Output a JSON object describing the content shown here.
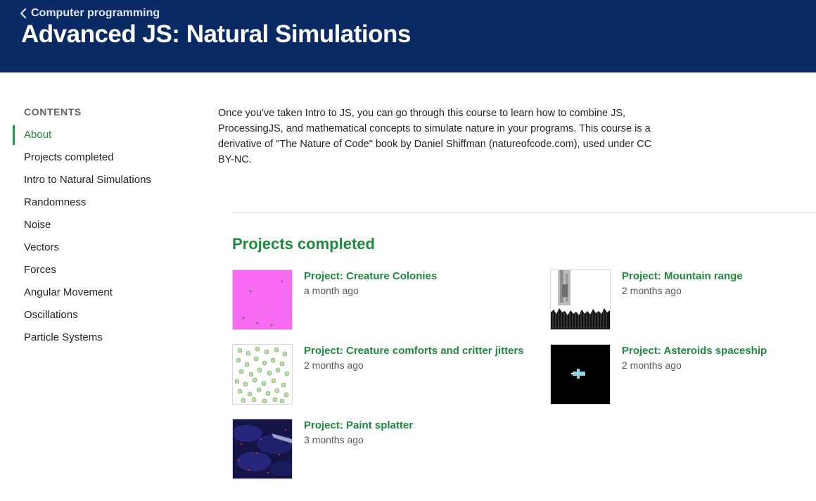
{
  "header": {
    "back_label": "Computer programming",
    "title": "Advanced JS: Natural Simulations"
  },
  "sidebar": {
    "heading": "CONTENTS",
    "items": [
      {
        "label": "About",
        "active": true
      },
      {
        "label": "Projects completed"
      },
      {
        "label": "Intro to Natural Simulations"
      },
      {
        "label": "Randomness"
      },
      {
        "label": "Noise"
      },
      {
        "label": "Vectors"
      },
      {
        "label": "Forces"
      },
      {
        "label": "Angular Movement"
      },
      {
        "label": "Oscillations"
      },
      {
        "label": "Particle Systems"
      }
    ]
  },
  "about": {
    "text": "Once you've taken Intro to JS, you can go through this course to learn how to combine JS, ProcessingJS, and mathematical concepts to simulate nature in your programs. This course is a derivative of \"The Nature of Code\" book by Daniel Shiffman (natureofcode.com), used under CC BY-NC."
  },
  "projects": {
    "heading": "Projects completed",
    "items": [
      {
        "title": "Project: Creature Colonies",
        "date": "a month ago"
      },
      {
        "title": "Project: Mountain range",
        "date": "2 months ago"
      },
      {
        "title": "Project: Creature comforts and critter jitters",
        "date": "2 months ago"
      },
      {
        "title": "Project: Asteroids spaceship",
        "date": "2 months ago"
      },
      {
        "title": "Project: Paint splatter",
        "date": "3 months ago"
      }
    ]
  },
  "colors": {
    "header_bg": "#0a2a66",
    "accent_green": "#1f8a3e",
    "text": "#21242c"
  }
}
